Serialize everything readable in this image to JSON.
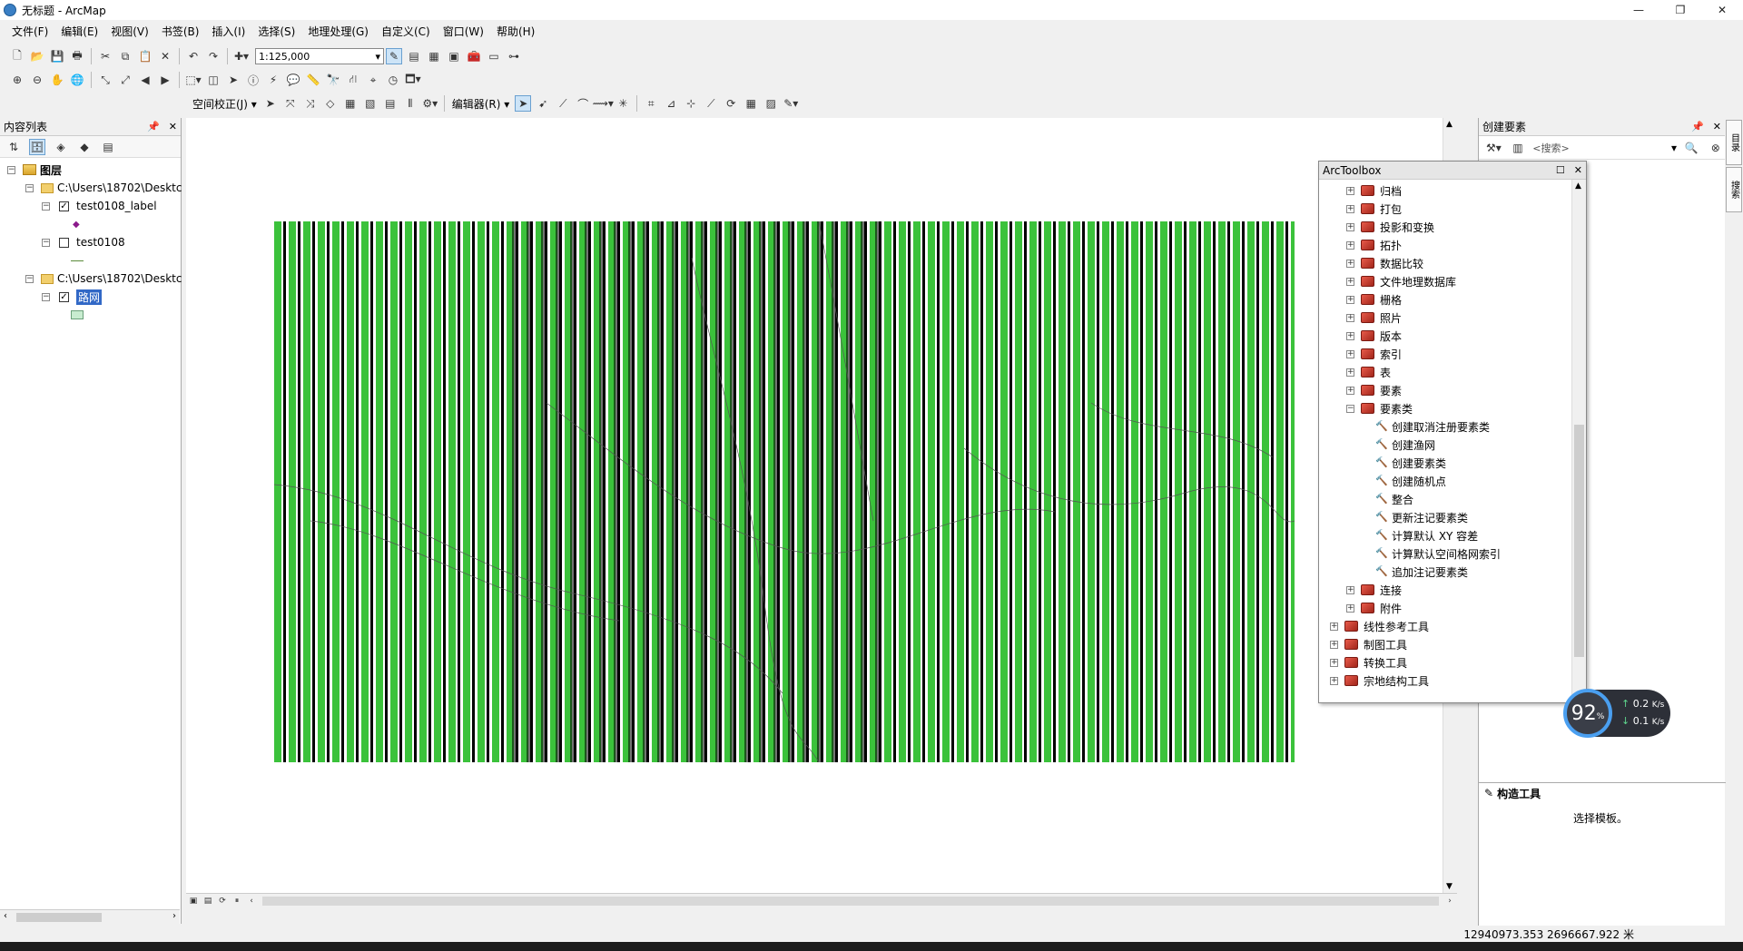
{
  "window": {
    "title": "无标题 - ArcMap",
    "minimize": "—",
    "restore": "❐",
    "close": "✕"
  },
  "menu": [
    "文件(F)",
    "编辑(E)",
    "视图(V)",
    "书签(B)",
    "插入(I)",
    "选择(S)",
    "地理处理(G)",
    "自定义(C)",
    "窗口(W)",
    "帮助(H)"
  ],
  "toolbar": {
    "scale": "1:125,000",
    "georef_label": "空间校正(J) ▾",
    "editor_label": "编辑器(R) ▾"
  },
  "toc": {
    "title": "内容列表",
    "root": "图层",
    "items": [
      {
        "label": "C:\\Users\\18702\\Desktc",
        "type": "folder"
      },
      {
        "label": "test0108_label",
        "checked": true
      },
      {
        "label": "test0108",
        "checked": false
      },
      {
        "label": "C:\\Users\\18702\\Desktc",
        "type": "folder"
      },
      {
        "label": "路网",
        "checked": true,
        "selected": true
      }
    ]
  },
  "toolbox": {
    "title": "ArcToolbox",
    "toolsets": [
      "归档",
      "打包",
      "投影和变换",
      "拓扑",
      "数据比较",
      "文件地理数据库",
      "栅格",
      "照片",
      "版本",
      "索引",
      "表",
      "要素",
      "要素类"
    ],
    "feature_class_tools": [
      "创建取消注册要素类",
      "创建渔网",
      "创建要素类",
      "创建随机点",
      "整合",
      "更新注记要素类",
      "计算默认 XY 容差",
      "计算默认空间格网索引",
      "追加注记要素类"
    ],
    "after_sets": [
      "连接",
      "附件"
    ],
    "toolboxes": [
      "线性参考工具",
      "制图工具",
      "转换工具",
      "宗地结构工具"
    ]
  },
  "create_features": {
    "title": "创建要素",
    "search_placeholder": "<搜索>",
    "construct_title": "构造工具",
    "construct_hint": "选择模板。"
  },
  "side_tabs": [
    "目录",
    "搜索"
  ],
  "net_widget": {
    "percent": "92",
    "unit": "%",
    "up": "0.2",
    "down": "0.1",
    "rate_unit": "K/s"
  },
  "status": {
    "coords": "12940973.353  2696667.922 米"
  },
  "colors": {
    "fishnet_green": "#3bc23b",
    "selection_blue": "#3168c6"
  }
}
